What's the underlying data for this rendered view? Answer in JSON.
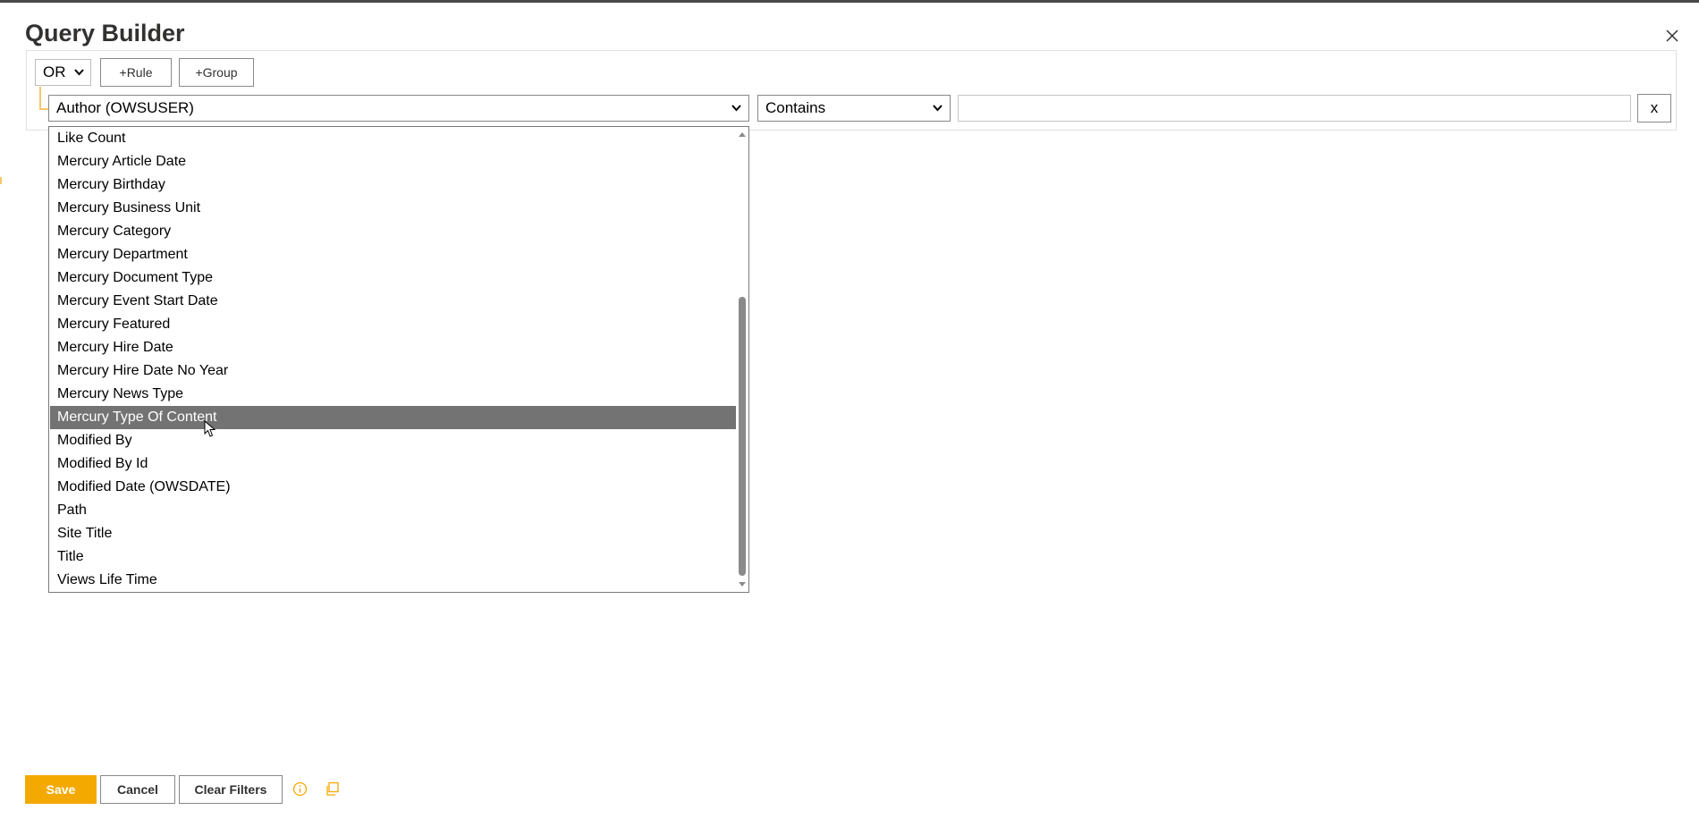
{
  "dialog": {
    "title": "Query Builder"
  },
  "toolbar": {
    "condition_value": "OR",
    "add_rule_label": "+Rule",
    "add_group_label": "+Group"
  },
  "rule": {
    "field_value": "Author (OWSUSER)",
    "operator_value": "Contains",
    "value": "",
    "delete_label": "x"
  },
  "dropdown": {
    "options": [
      "Like Count",
      "Mercury Article Date",
      "Mercury Birthday",
      "Mercury Business Unit",
      "Mercury Category",
      "Mercury Department",
      "Mercury Document Type",
      "Mercury Event Start Date",
      "Mercury Featured",
      "Mercury Hire Date",
      "Mercury Hire Date No Year",
      "Mercury News Type",
      "Mercury Type Of Content",
      "Modified By",
      "Modified By Id",
      "Modified Date (OWSDATE)",
      "Path",
      "Site Title",
      "Title",
      "Views Life Time"
    ],
    "highlighted": "Mercury Type Of Content"
  },
  "footer": {
    "save_label": "Save",
    "cancel_label": "Cancel",
    "clear_label": "Clear Filters"
  },
  "colors": {
    "accent": "#f4a900",
    "highlight": "#737373",
    "tree_line": "#f5c768"
  },
  "icons": [
    "close-icon",
    "chevron-down-icon",
    "info-icon",
    "copy-icon",
    "mouse-cursor-icon"
  ]
}
